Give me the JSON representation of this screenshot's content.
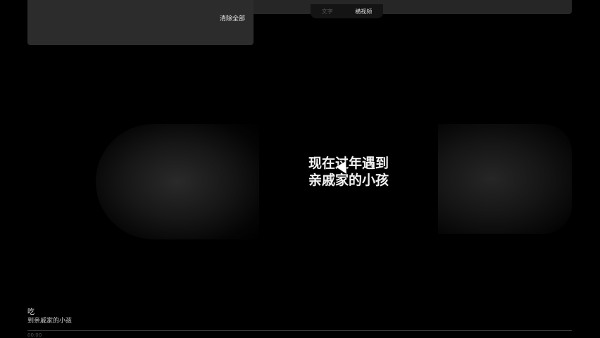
{
  "panel": {
    "clear_all_label": "清除全部"
  },
  "tabs": [
    {
      "label": "文字"
    },
    {
      "label": "横视频"
    }
  ],
  "video": {
    "subtitle_line1": "现在过年遇到",
    "subtitle_line2": "亲戚家的小孩"
  },
  "bottom": {
    "title": "吃",
    "caption": "到亲戚家的小孩",
    "extra": "00:00"
  }
}
